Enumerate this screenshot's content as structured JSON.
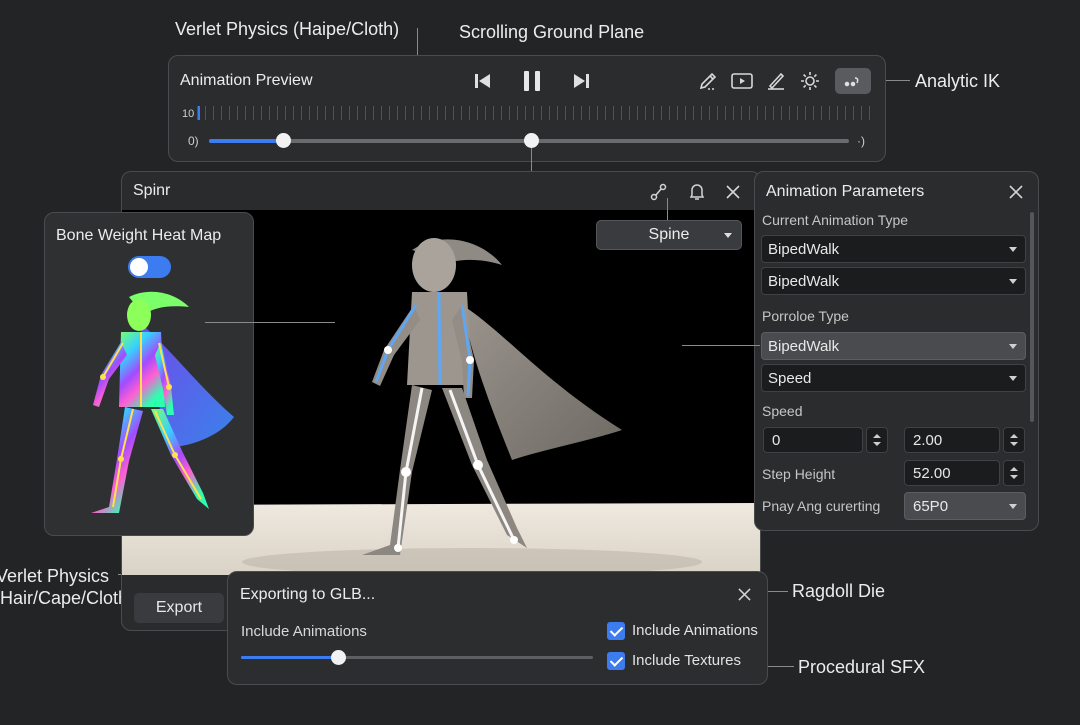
{
  "callouts": {
    "verlet_top": "Verlet Physics (Haipe/Cloth)",
    "scrolling": "Scrolling Ground Plane",
    "analytic_ik": "Analytic IK",
    "verlet_bottom_line1": "Verlet Physics",
    "verlet_bottom_line2": "(Hair/Cape/Cloth)",
    "ragdoll": "Ragdoll Die",
    "procedural_sfx": "Procedural SFX"
  },
  "preview": {
    "title": "Animation Preview",
    "ruler_label": "10",
    "slider_left_label": "0)",
    "slider_right_label": "·)",
    "scrub_progress_pct": 9,
    "scrub_head_pct": 50
  },
  "viewport": {
    "title": "Spinr",
    "dropdown_value": "Spine",
    "export_label": "Export"
  },
  "heatmap": {
    "title": "Bone Weight Heat Map",
    "toggle_on": true
  },
  "params": {
    "title": "Animation Parameters",
    "current_type_label": "Current Animation Type",
    "dropdown1": "BipedWalk",
    "dropdown2": "BipedWalk",
    "porroloe_label": "Porroloe Type",
    "dropdown3": "BipedWalk",
    "dropdown4": "Speed",
    "speed_label": "Speed",
    "speed_min": "0",
    "speed_max": "2.00",
    "step_height_label": "Step Height",
    "step_height_value": "52.00",
    "pnay_label": "Pnay Ang curerting",
    "pnay_value": "65P0"
  },
  "export": {
    "title": "Exporting to GLB...",
    "slider_label": "Include Animations",
    "slider_pct": 29,
    "check1": "Include Animations",
    "check2": "Include Textures"
  },
  "colors": {
    "accent": "#3d7cf0",
    "panel": "#2b2c2e"
  }
}
